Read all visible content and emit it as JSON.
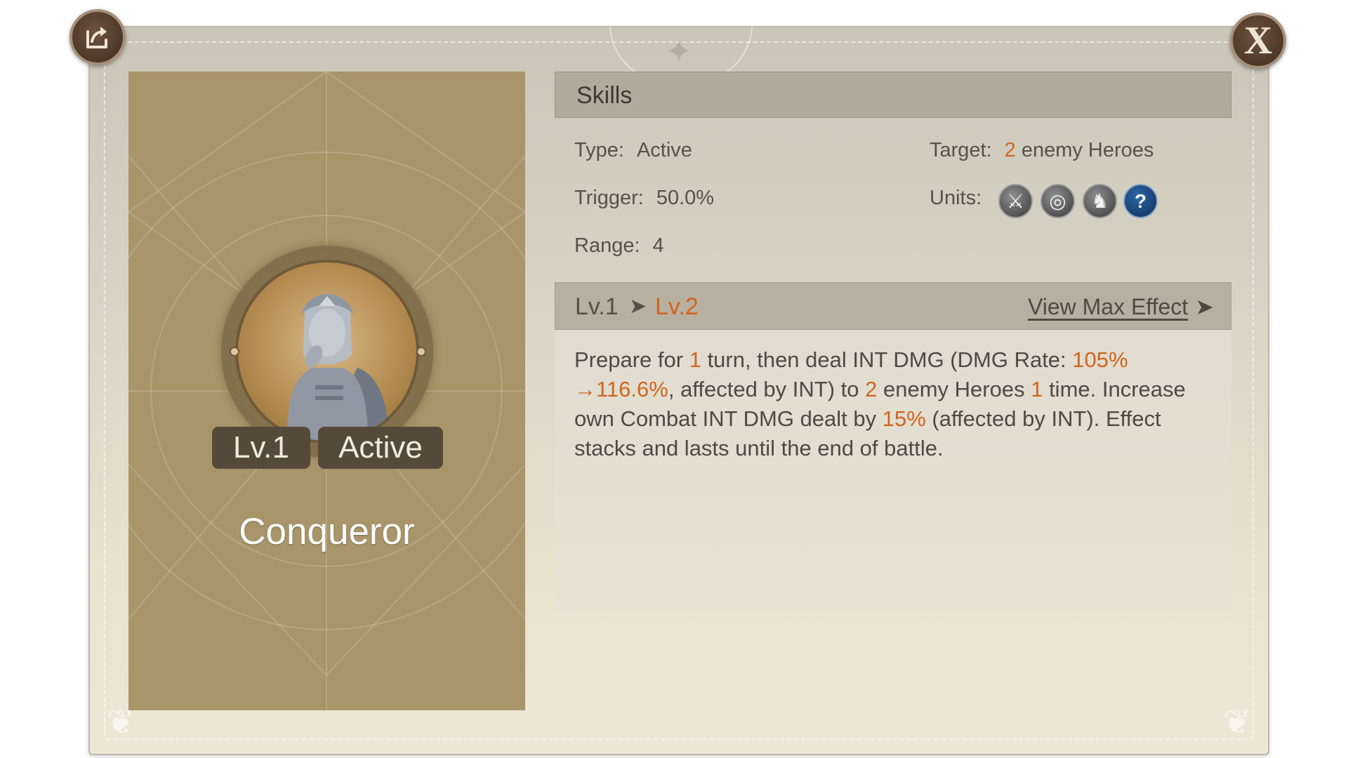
{
  "window": {
    "share_icon": "share-icon",
    "close_label": "X"
  },
  "skill_card": {
    "level_badge": "Lv.1",
    "type_badge": "Active",
    "name": "Conqueror"
  },
  "skills": {
    "header": "Skills",
    "type_label": "Type:",
    "type_value": "Active",
    "trigger_label": "Trigger:",
    "trigger_value": "50.0%",
    "range_label": "Range:",
    "range_value": "4",
    "target_label": "Target:",
    "target_count": "2",
    "target_value": "enemy Heroes",
    "units_label": "Units:",
    "units": [
      {
        "icon": "sword-icon",
        "glyph": "⚔"
      },
      {
        "icon": "target-icon",
        "glyph": "◎"
      },
      {
        "icon": "horse-icon",
        "glyph": "♞"
      },
      {
        "icon": "question-icon",
        "glyph": "?"
      }
    ]
  },
  "level": {
    "from": "Lv.1",
    "to": "Lv.2",
    "view_max": "View Max Effect"
  },
  "effect": {
    "p1": "Prepare for ",
    "turns": "1",
    "p2": " turn, then deal INT DMG (DMG Rate: ",
    "rate_from": "105%",
    "rate_to": "→116.6%",
    "p3": ", affected by INT) to ",
    "targets": "2",
    "p4": " enemy Heroes ",
    "times": "1",
    "p5": " time. Increase own Combat INT DMG dealt by ",
    "bonus": "15%",
    "p6": " (affected by INT). Effect stacks and lasts until the end of battle."
  },
  "colors": {
    "highlight": "#d2641f",
    "card": "#a8956a",
    "text": "#4e4a43"
  }
}
